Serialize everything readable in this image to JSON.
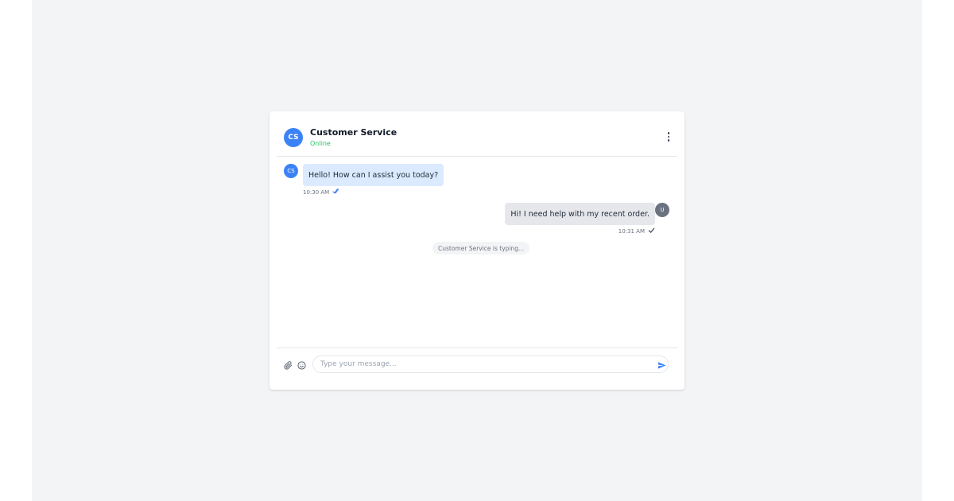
{
  "header": {
    "avatar_initials": "CS",
    "title": "Customer Service",
    "status": "Online",
    "status_color": "#22c55e",
    "menu_icon": "more-vertical-icon"
  },
  "messages": [
    {
      "sender": "agent",
      "avatar_initials": "CS",
      "text": "Hello! How can I assist you today?",
      "time": "10:30 AM",
      "receipt_icon": "double-check-icon",
      "bubble_color": "#dbeafe"
    },
    {
      "sender": "user",
      "avatar_initials": "U",
      "text": "Hi! I need help with my recent order.",
      "time": "10:31 AM",
      "receipt_icon": "check-icon",
      "bubble_color": "#e5e7eb"
    }
  ],
  "typing": {
    "text": "Customer Service is typing..."
  },
  "composer": {
    "placeholder": "Type your message...",
    "value": "",
    "attach_icon": "paperclip-icon",
    "emoji_icon": "smile-icon",
    "send_icon": "send-icon"
  },
  "colors": {
    "accent": "#3b82f6",
    "background": "#f3f4f6"
  }
}
